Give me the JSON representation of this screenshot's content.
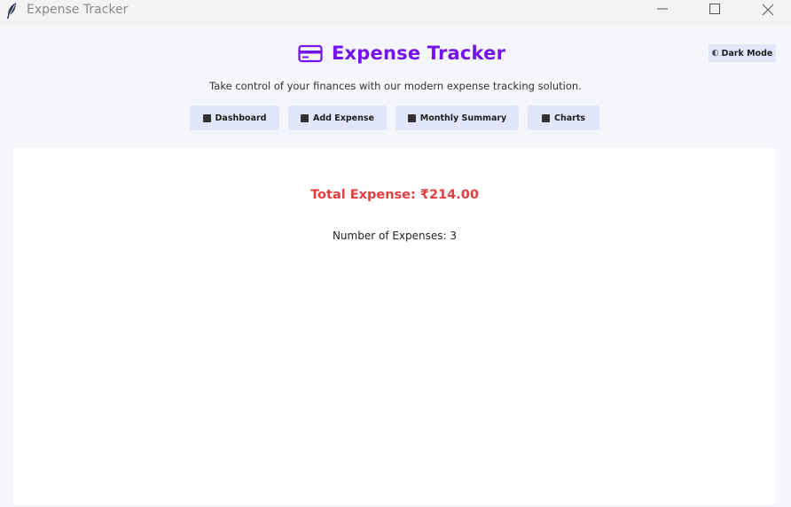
{
  "window": {
    "title": "Expense Tracker"
  },
  "header": {
    "title": "Expense Tracker",
    "subtitle": "Take control of your finances with our modern expense tracking solution.",
    "dark_mode_label": "Dark Mode",
    "accent_color": "#7413ee"
  },
  "nav": {
    "dashboard": "Dashboard",
    "add_expense": "Add Expense",
    "monthly_summary": "Monthly Summary",
    "charts": "Charts",
    "button_color": "#e1e6fb"
  },
  "dashboard": {
    "total_label": "Total Expense: ₹214.00",
    "count_label": "Number of Expenses: 3",
    "total_color": "#e53e3e"
  },
  "icons": {
    "app": "feather-icon",
    "brand": "credit-card-icon",
    "dark_mode": "moon-icon",
    "dashboard": "chart-bar-icon",
    "add_expense": "memo-icon",
    "monthly_summary": "calendar-icon",
    "charts": "charts-icon"
  }
}
